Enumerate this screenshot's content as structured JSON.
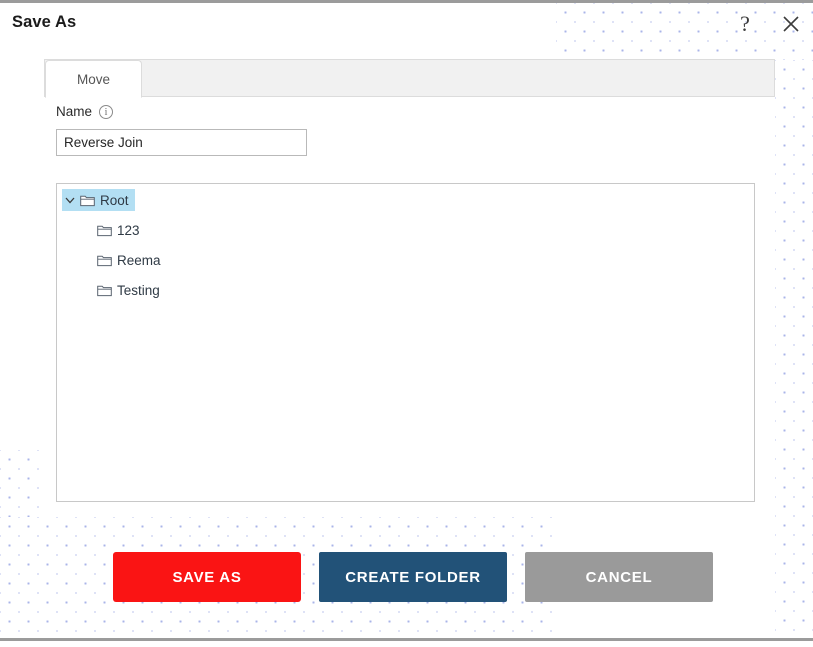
{
  "dialog": {
    "title": "Save As",
    "help_icon": "question-mark-icon",
    "close_icon": "close-icon"
  },
  "tabs": [
    {
      "label": "Move",
      "active": true
    }
  ],
  "form": {
    "name_label": "Name",
    "info_icon": "info-icon",
    "name_value": "Reverse Join",
    "name_placeholder": "Name"
  },
  "tree": {
    "root": {
      "label": "Root",
      "selected": true,
      "expanded": true,
      "chevron_icon": "chevron-down-icon",
      "folder_icon": "folder-icon"
    },
    "children": [
      {
        "label": "123",
        "folder_icon": "folder-icon"
      },
      {
        "label": "Reema",
        "folder_icon": "folder-icon"
      },
      {
        "label": "Testing",
        "folder_icon": "folder-icon"
      }
    ]
  },
  "buttons": {
    "save_as": "SAVE AS",
    "create_folder": "CREATE FOLDER",
    "cancel": "CANCEL"
  },
  "colors": {
    "save_as": "#fa1414",
    "create_folder": "#225278",
    "cancel": "#9a9a9a",
    "selection": "#b3dff3",
    "dot_pattern": "#aab4e8"
  }
}
